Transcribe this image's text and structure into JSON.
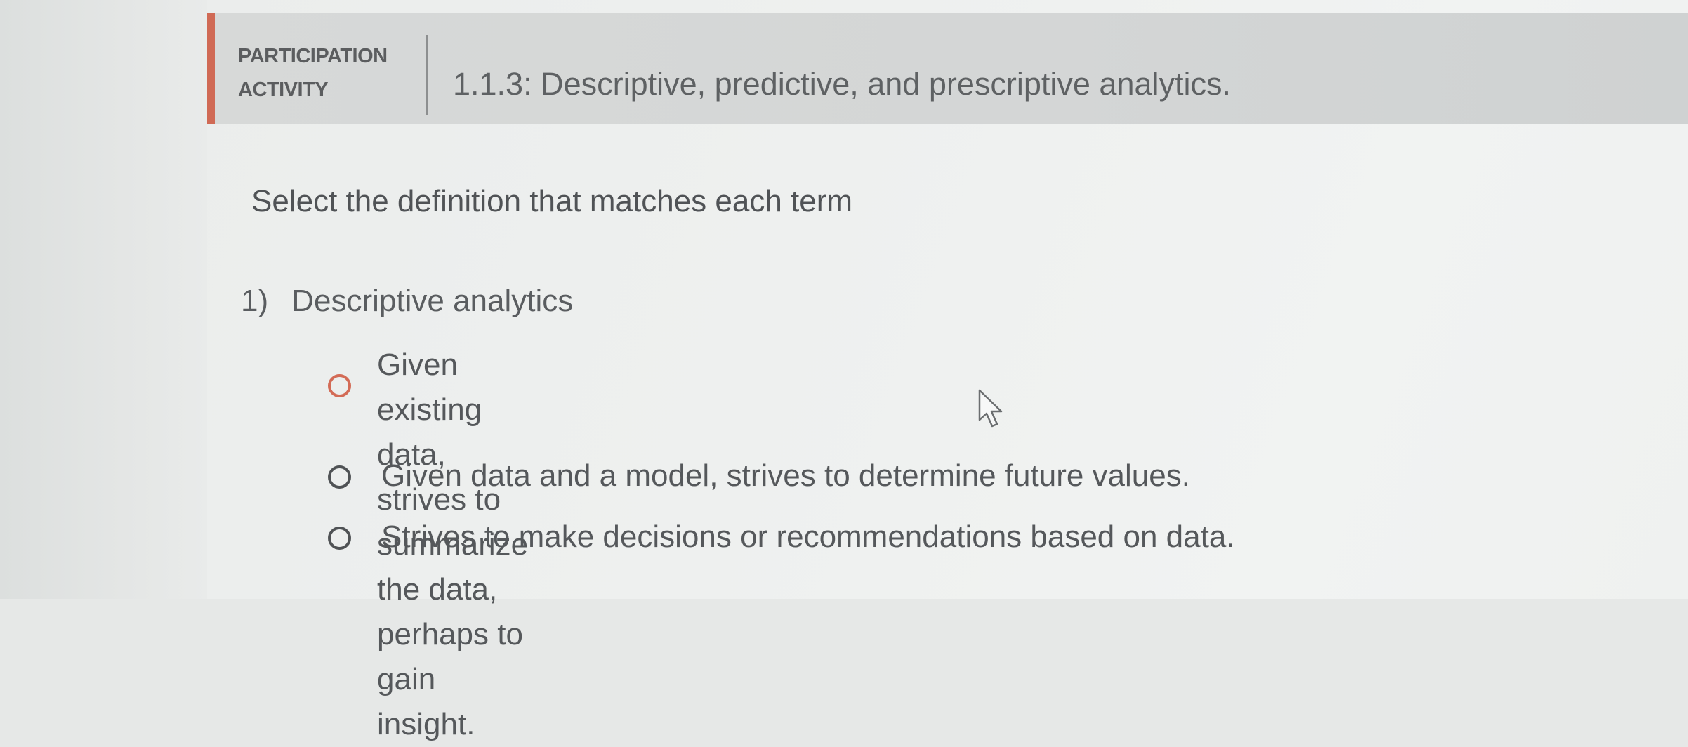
{
  "activity": {
    "tag_line1": "PARTICIPATION",
    "tag_line2": "ACTIVITY",
    "title": "1.1.3: Descriptive, predictive, and prescriptive analytics.",
    "accent_color": "#d06a55"
  },
  "instructions": "Select the definition that matches each term",
  "question": {
    "number": "1)",
    "term": "Descriptive analytics",
    "options": [
      {
        "text_line1": "Given existing data, strives to summarize the data, perhaps to",
        "text_line2": "gain insight.",
        "radio_color": "red"
      },
      {
        "text_line1": "Given data and a model, strives to determine future values.",
        "radio_color": "gray"
      },
      {
        "text_line1": "Strives to make decisions or recommendations based on data.",
        "radio_color": "gray"
      }
    ]
  },
  "icons": {
    "cursor": "mouse-pointer-icon",
    "radio": "radio-button-icon"
  }
}
